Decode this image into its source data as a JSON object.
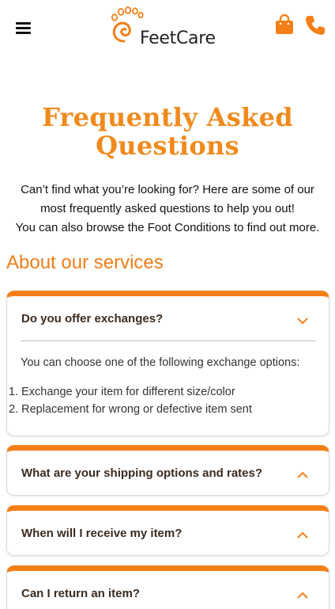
{
  "header": {
    "brand": "FeetCare",
    "menu_icon": "hamburger-menu-icon",
    "cart_icon": "shopping-bag-icon",
    "call_icon": "phone-icon",
    "accent_color": "#f57f17"
  },
  "page": {
    "title_line1": "Frequently Asked",
    "title_line2": "Questions",
    "intro_line1": "Can’t find what you’re looking for? Here are some of our",
    "intro_line2": "most frequently asked questions to help you out!",
    "intro_line3": "You can also browse the Foot Conditions to find out more."
  },
  "section": {
    "heading": "About our services"
  },
  "faqs": [
    {
      "question": "Do you offer exchanges?",
      "expanded": true,
      "answer": "You can choose one of the following exchange options:",
      "list": [
        "1. Exchange your item for different size/color",
        "2. Replacement for wrong or defective item sent"
      ]
    },
    {
      "question": "What are your shipping options and rates?",
      "expanded": false
    },
    {
      "question": "When will I receive my item?",
      "expanded": false
    },
    {
      "question": "Can I return an item?",
      "expanded": false
    }
  ]
}
